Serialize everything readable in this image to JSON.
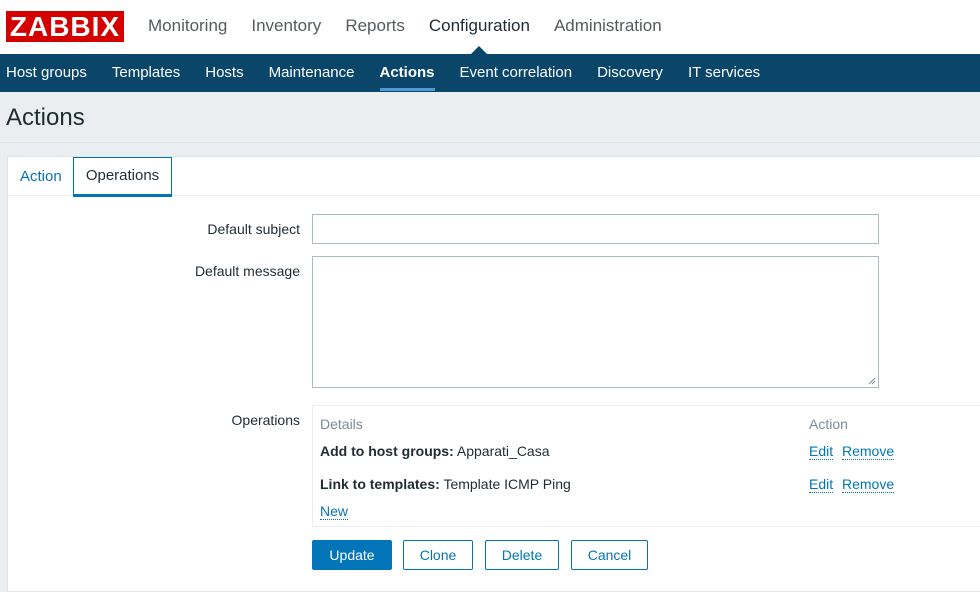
{
  "header": {
    "logo": "ZABBIX",
    "top_nav": [
      "Monitoring",
      "Inventory",
      "Reports",
      "Configuration",
      "Administration"
    ],
    "active_top": "Configuration"
  },
  "sub_nav": {
    "items": [
      "Host groups",
      "Templates",
      "Hosts",
      "Maintenance",
      "Actions",
      "Event correlation",
      "Discovery",
      "IT services"
    ],
    "active": "Actions"
  },
  "page": {
    "title": "Actions"
  },
  "tabs": {
    "action": "Action",
    "operations": "Operations",
    "active": "Operations"
  },
  "form": {
    "default_subject_label": "Default subject",
    "default_subject_value": "",
    "default_message_label": "Default message",
    "default_message_value": "",
    "operations_label": "Operations"
  },
  "operations": {
    "details_header": "Details",
    "action_header": "Action",
    "rows": [
      {
        "type": "Add to host groups:",
        "value": "Apparati_Casa",
        "edit": "Edit",
        "remove": "Remove"
      },
      {
        "type": "Link to templates:",
        "value": "Template ICMP Ping",
        "edit": "Edit",
        "remove": "Remove"
      }
    ],
    "new_link": "New"
  },
  "buttons": {
    "update": "Update",
    "clone": "Clone",
    "delete": "Delete",
    "cancel": "Cancel"
  },
  "colors": {
    "brand_red": "#d40000",
    "subnav_bg": "#0a466a",
    "link_blue": "#0275b8"
  }
}
